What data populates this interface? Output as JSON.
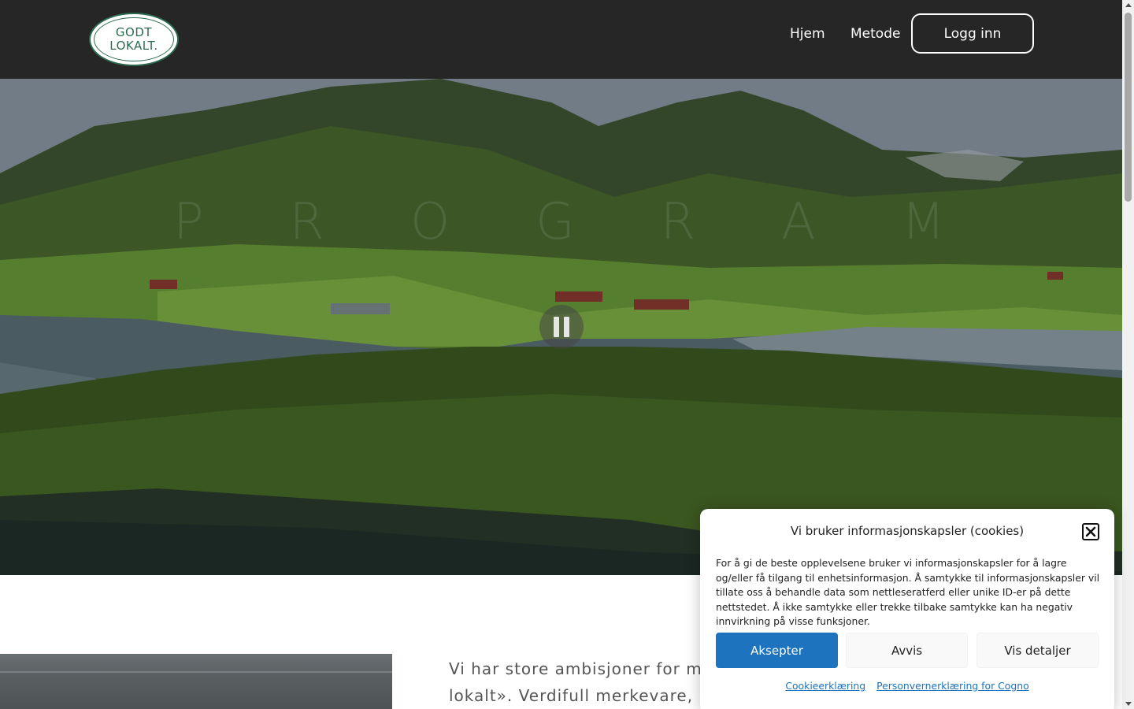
{
  "header": {
    "logo": {
      "line1": "GODT",
      "line2": "LOKALT."
    },
    "nav": [
      {
        "label": "Hjem"
      },
      {
        "label": "Metode"
      }
    ],
    "login_label": "Logg inn"
  },
  "hero": {
    "watermark_letters": [
      "P",
      "R",
      "O",
      "G",
      "R",
      "A",
      "M"
    ],
    "pause_icon": "pause-icon"
  },
  "intro": {
    "line1": "Vi har store ambisjoner for mer",
    "line2": "lokalt». Verdifull merkevare, høy"
  },
  "cookie": {
    "title": "Vi bruker informasjonskapsler (cookies)",
    "body": "For å gi de beste opplevelsene bruker vi informasjonskapsler for å lagre og/eller få tilgang til enhetsinformasjon. Å samtykke til informasjonskapsler vil tillate oss å behandle data som nettleseratferd eller unike ID-er på dette nettstedet. Å ikke samtykke eller trekke tilbake samtykke kan ha negativ innvirkning på visse funksjoner.",
    "accept_label": "Aksepter",
    "deny_label": "Avvis",
    "details_label": "Vis detaljer",
    "link1": "Cookieerklæring",
    "link2": "Personvernerklæring for Cogno",
    "accent_color": "#1e73be"
  }
}
